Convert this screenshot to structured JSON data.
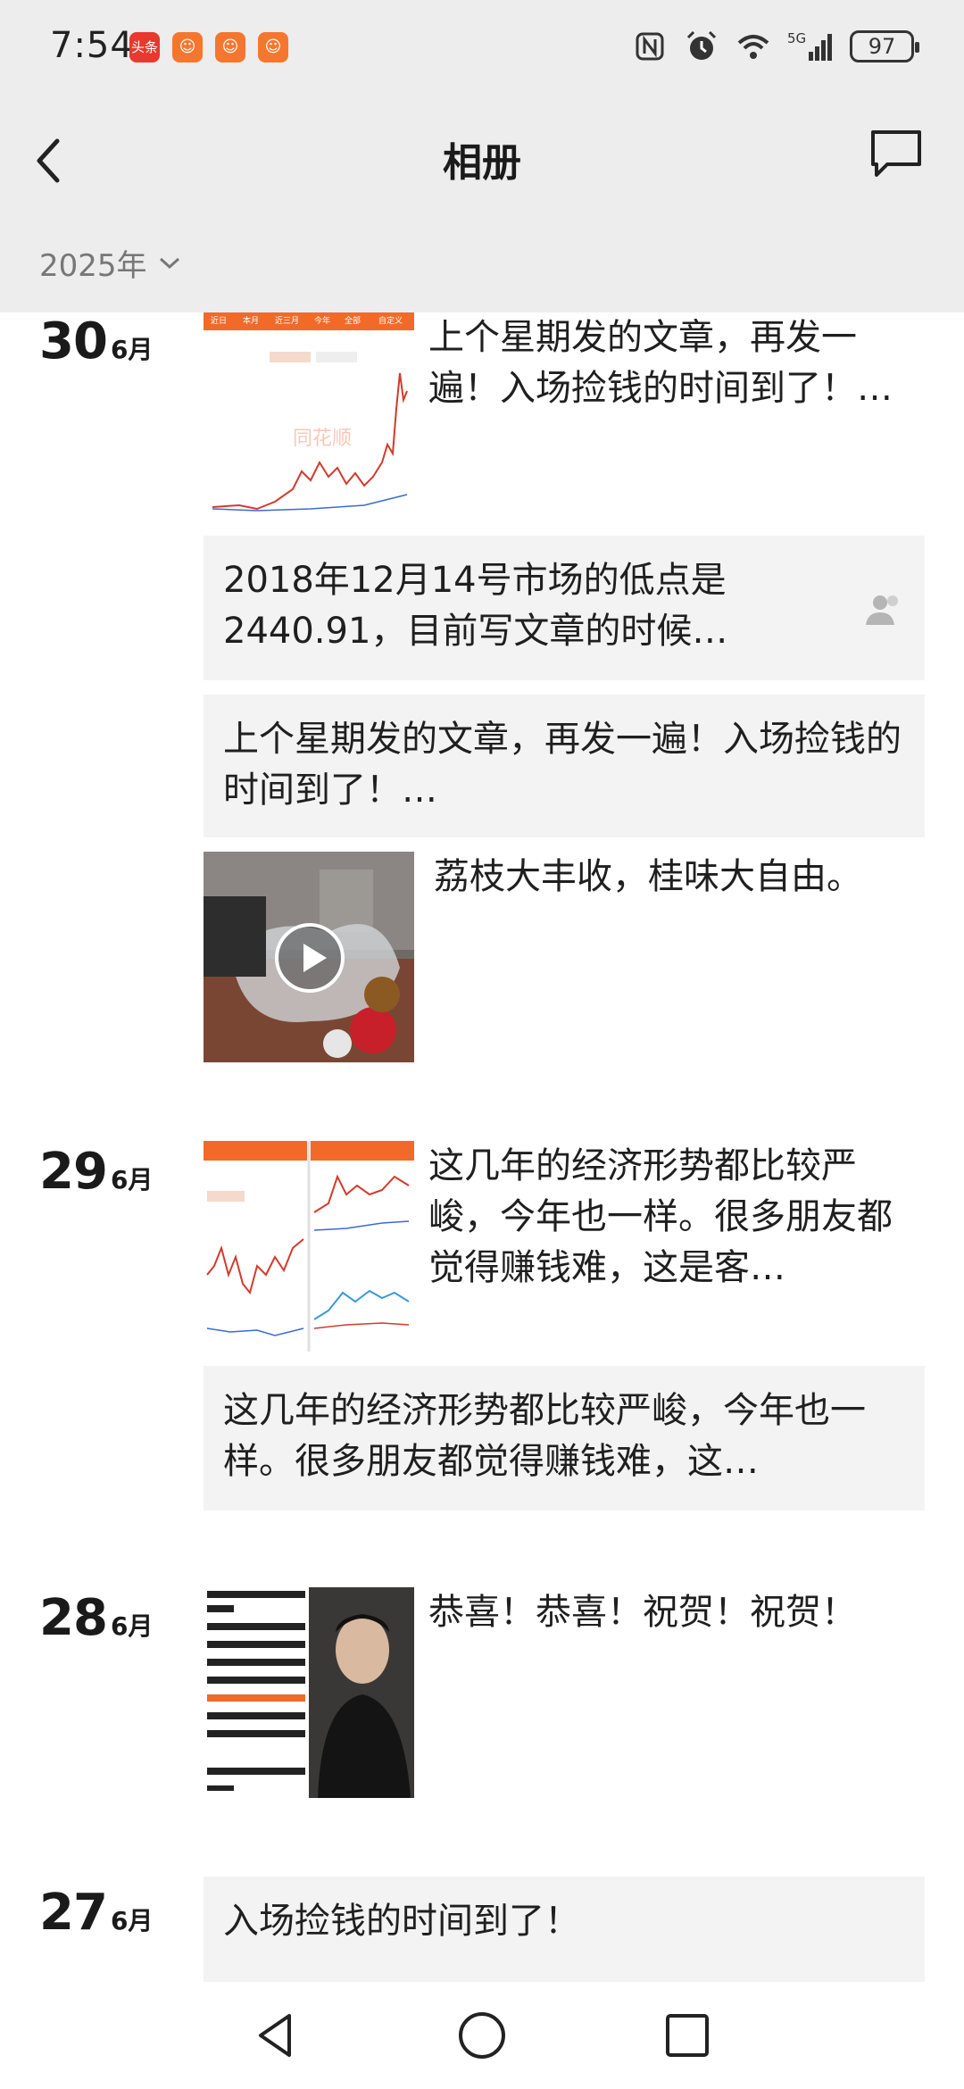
{
  "status_bar": {
    "time": "7:54",
    "app_badges": [
      "头条",
      "",
      "",
      ""
    ],
    "battery": "97",
    "network": "5G"
  },
  "header": {
    "title": "相册",
    "year": "2025年"
  },
  "feed": {
    "days": [
      {
        "day": "30",
        "month": "6月"
      },
      {
        "day": "29",
        "month": "6月"
      },
      {
        "day": "28",
        "month": "6月"
      },
      {
        "day": "27",
        "month": "6月"
      }
    ],
    "posts": [
      {
        "text": "上个星期发的文章，再发一遍！入场捡钱的时间到了！…",
        "thumb": "stock-chart"
      },
      {
        "text": "2018年12月14号市场的低点是2440.91，目前写文章的时候…",
        "thumb": "none",
        "badge": "private-icon"
      },
      {
        "text": "上个星期发的文章，再发一遍！入场捡钱的时间到了！…",
        "thumb": "none"
      },
      {
        "text": "荔枝大丰收，桂味大自由。",
        "thumb": "video"
      },
      {
        "text": "这几年的经济形势都比较严峻，今年也一样。很多朋友都觉得赚钱难，这是客…",
        "thumb": "stock-charts"
      },
      {
        "text": "这几年的经济形势都比较严峻，今年也一样。很多朋友都觉得赚钱难，这…",
        "thumb": "none"
      },
      {
        "text": "恭喜！恭喜！祝贺！祝贺！",
        "thumb": "poster"
      },
      {
        "text": "入场捡钱的时间到了！",
        "thumb": "none"
      }
    ]
  },
  "colors": {
    "header_bg": "#ededed",
    "card_bg": "#f3f3f3",
    "accent_orange": "#f5762e"
  }
}
